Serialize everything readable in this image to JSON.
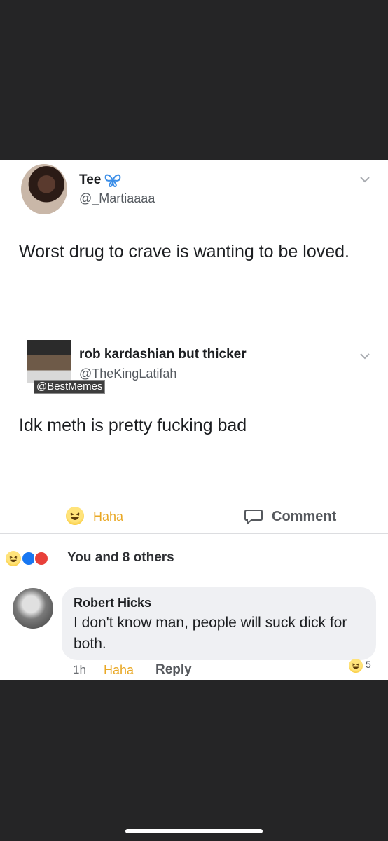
{
  "tweet1": {
    "display_name": "Tee",
    "handle": "@_Martiaaaa",
    "text": "Worst drug to crave is wanting to be loved."
  },
  "tweet2": {
    "display_name": "rob kardashian but thicker",
    "handle": "@TheKingLatifah",
    "watermark": "@BestMemes",
    "text": "Idk meth is pretty fucking bad"
  },
  "actions": {
    "haha_label": "Haha",
    "comment_label": "Comment"
  },
  "reactions_summary": "You and 8 others",
  "comment": {
    "author": "Robert Hicks",
    "text": "I don't know man, people will suck dick for both.",
    "time": "1h",
    "haha_label": "Haha",
    "reply_label": "Reply",
    "reaction_count": "5"
  },
  "colors": {
    "haha_yellow": "#e9a825",
    "like_blue": "#1877f2",
    "love_red": "#e8403a"
  }
}
